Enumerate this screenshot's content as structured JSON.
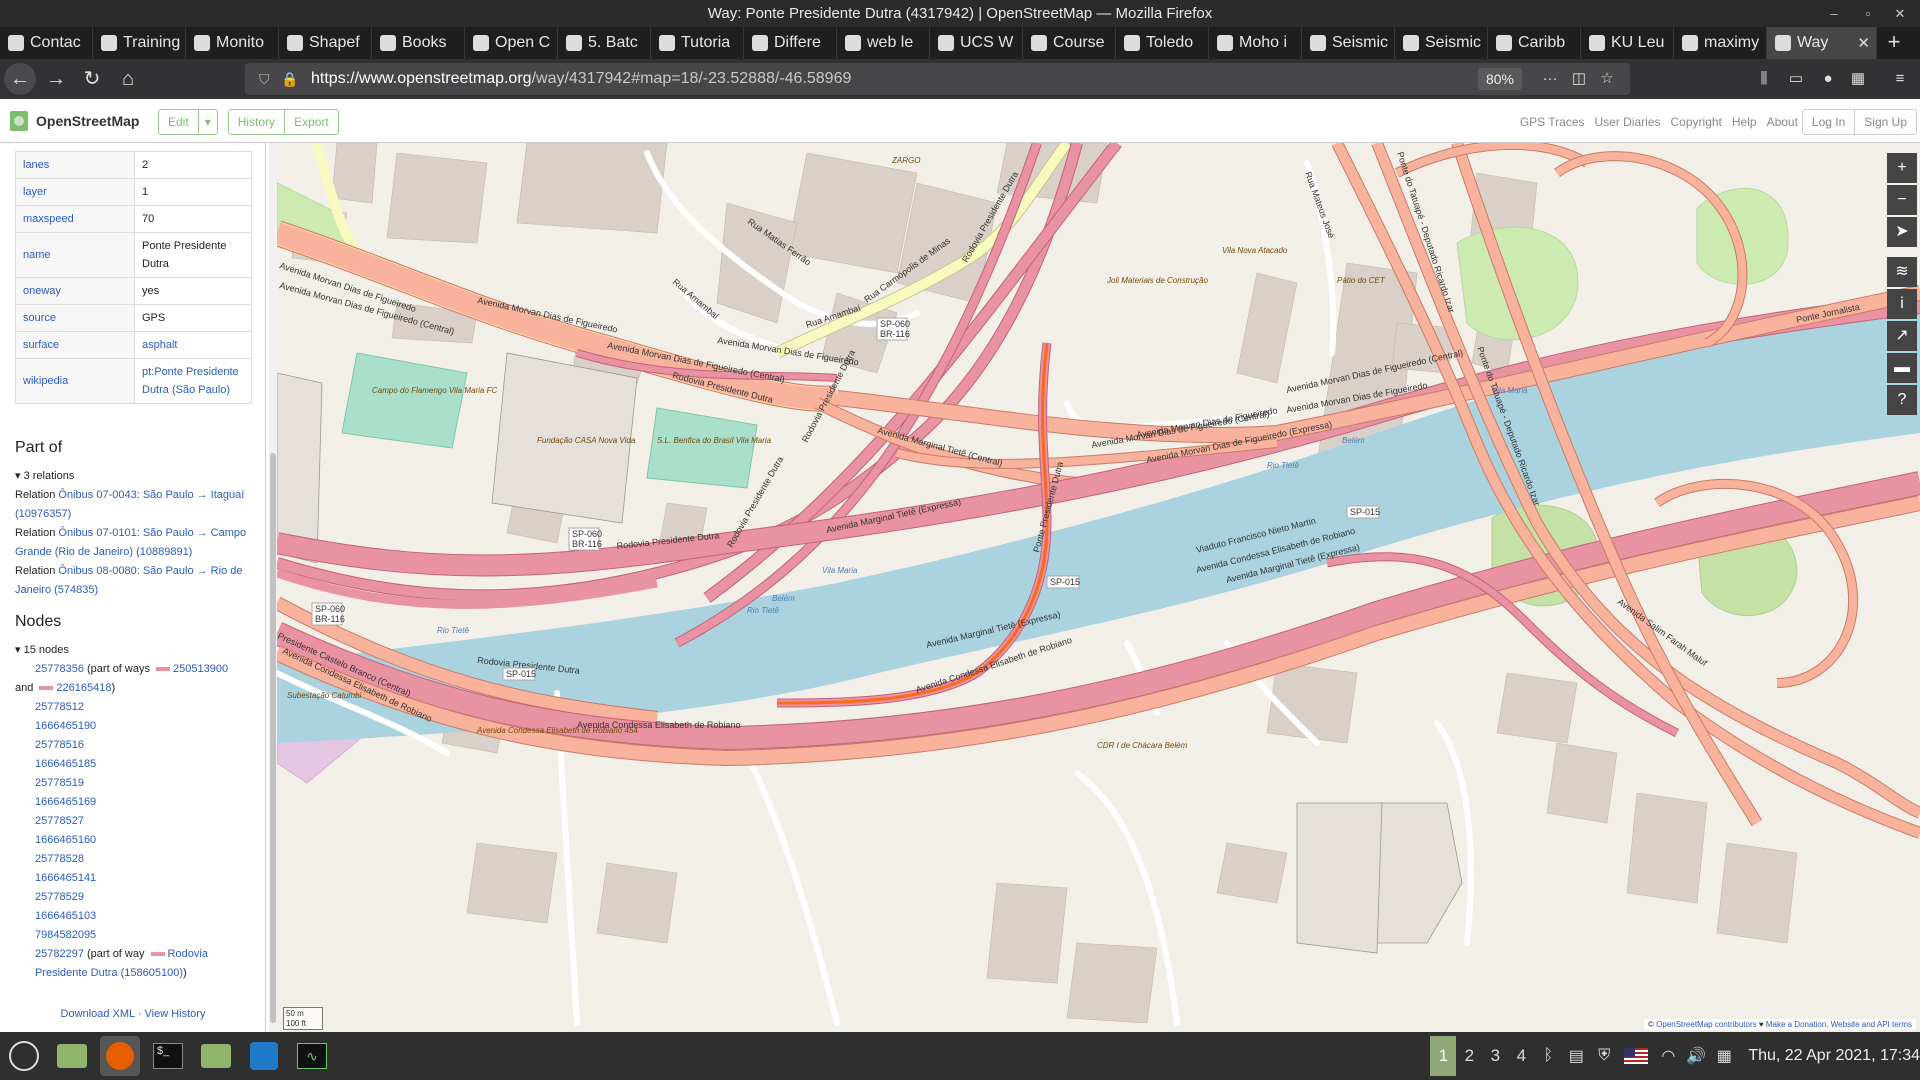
{
  "window": {
    "title": "Way: Ponte Presidente Dutra (4317942) | OpenStreetMap — Mozilla Firefox"
  },
  "tabs": [
    {
      "label": "Contac",
      "icon": "contacts-icon"
    },
    {
      "label": "Training p",
      "icon": "document-icon"
    },
    {
      "label": "Monito",
      "icon": "page-icon"
    },
    {
      "label": "Shapef",
      "icon": "shapefile-icon"
    },
    {
      "label": "Books",
      "icon": "books-icon"
    },
    {
      "label": "Open C",
      "icon": "open-icon"
    },
    {
      "label": "5. Batc",
      "icon": "batch-icon"
    },
    {
      "label": "Tutoria",
      "icon": "tutorial-icon"
    },
    {
      "label": "Differe",
      "icon": "page-icon"
    },
    {
      "label": "web le",
      "icon": "t-icon"
    },
    {
      "label": "UCS W",
      "icon": "t-icon"
    },
    {
      "label": "Course",
      "icon": "t-icon"
    },
    {
      "label": "Toledo",
      "icon": "t-icon"
    },
    {
      "label": "Moho i",
      "icon": "moho-icon"
    },
    {
      "label": "Seismic",
      "icon": "wave-icon"
    },
    {
      "label": "Seismic",
      "icon": "seismic-icon"
    },
    {
      "label": "Caribb",
      "icon": "wikipedia-icon"
    },
    {
      "label": "KU Leu",
      "icon": "x-icon"
    },
    {
      "label": "maximy",
      "icon": "github-icon"
    },
    {
      "label": "Way",
      "icon": "osm-icon",
      "active": true
    }
  ],
  "nav": {
    "url_host": "https://www.openstreetmap.org",
    "url_path": "/way/4317942#map=18/-23.52888/-46.58969",
    "zoom": "80%"
  },
  "osm": {
    "logo_text": "OpenStreetMap",
    "buttons": {
      "edit": "Edit",
      "dropdown": "▾",
      "history": "History",
      "export": "Export"
    },
    "links": [
      "GPS Traces",
      "User Diaries",
      "Copyright",
      "Help",
      "About"
    ],
    "login": "Log In",
    "signup": "Sign Up"
  },
  "tags": [
    {
      "key": "lanes",
      "value": "2"
    },
    {
      "key": "layer",
      "value": "1"
    },
    {
      "key": "maxspeed",
      "value": "70"
    },
    {
      "key": "name",
      "value": "Ponte Presidente Dutra"
    },
    {
      "key": "oneway",
      "value": "yes"
    },
    {
      "key": "source",
      "value": "GPS"
    },
    {
      "key": "surface",
      "value": "asphalt",
      "link": true
    },
    {
      "key": "wikipedia",
      "value": "pt:Ponte Presidente Dutra (São Paulo)",
      "link": true
    }
  ],
  "part_of": {
    "heading": "Part of",
    "count": "3 relations",
    "relations": [
      {
        "prefix": "Relation ",
        "name": "Ônibus 07-0043: São Paulo → Itaguaí",
        "id": "(10976357)"
      },
      {
        "prefix": "Relation ",
        "name": "Ônibus 07-0101: São Paulo → Campo Grande (Rio de Janeiro)",
        "id": "(10889891)"
      },
      {
        "prefix": "Relation ",
        "name": "Ônibus 08-0080: São Paulo → Rio de Janeiro",
        "id": "(574835)"
      }
    ]
  },
  "nodes": {
    "heading": "Nodes",
    "count": "15 nodes",
    "first": {
      "id": "25778356",
      "text1": "(part of ways",
      "way1": "250513900",
      "and": "and",
      "way2": "226165418",
      "close": ")"
    },
    "list": [
      "25778512",
      "1666465190",
      "25778516",
      "1666465185",
      "25778519",
      "1666465169",
      "25778527",
      "1666465160",
      "25778528",
      "1666465141",
      "25778529",
      "1666465103",
      "7984582095"
    ],
    "last": {
      "id": "25782297",
      "text1": "(part of way",
      "way": "Rodovia Presidente Dutra (158605100)",
      "close": ")"
    }
  },
  "sidebar_footer": {
    "xml": "Download XML",
    "sep": " · ",
    "history": "View History"
  },
  "map": {
    "scale_m": "50 m",
    "scale_ft": "100 ft",
    "attribution_pre": "© ",
    "attribution_link": "OpenStreetMap contributors",
    "attribution_mid": " ♥ ",
    "attribution_donate": "Make a Donation",
    "attribution_end": ". Website and API terms",
    "street_labels": [
      "Avenida Morvan Dias de Figueiredo",
      "Avenida Morvan Dias de Figueiredo (Central)",
      "Avenida Morvan Dias de Figueiredo (Expressa)",
      "Avenida Marginal Tietê (Central)",
      "Avenida Marginal Tietê (Expressa)",
      "Rodovia Presidente Dutra",
      "Avenida Condessa Elisabeth de Robiano",
      "Presidente Castelo Branco (Central)",
      "Viaduto Francisco Nieto Martin",
      "Rua Carmópolis de Minas",
      "Rua Amambaí",
      "Rua Matias Ferrão",
      "Rua Mateus José",
      "Avenida Salim Farah Maluf",
      "Ponte do Tatuapé - Deputado Ricardo Izar",
      "Ponte Jornalista",
      "Ponte Presidente Dutra"
    ],
    "shields": [
      "SP-060",
      "BR-116",
      "SP-015"
    ],
    "places": [
      "Campo do Flamengo Vila Maria FC",
      "Fundação CASA Nova Vida",
      "S.L. Benfica do Brasil Vila Maria",
      "Joli Materiais de Construção",
      "Vila Nova Atacado",
      "Pátio do CET",
      "Subestação Catumbi",
      "CDR I de Chácara Belém",
      "Avenida Condessa Elisabeth de Robiano 454",
      "ZARGO"
    ],
    "water": [
      "Rio Tietê",
      "Vila Maria",
      "Belém"
    ]
  },
  "taskbar": {
    "workspaces": [
      "1",
      "2",
      "3",
      "4"
    ],
    "clock": "Thu, 22 Apr 2021, 17:34"
  }
}
